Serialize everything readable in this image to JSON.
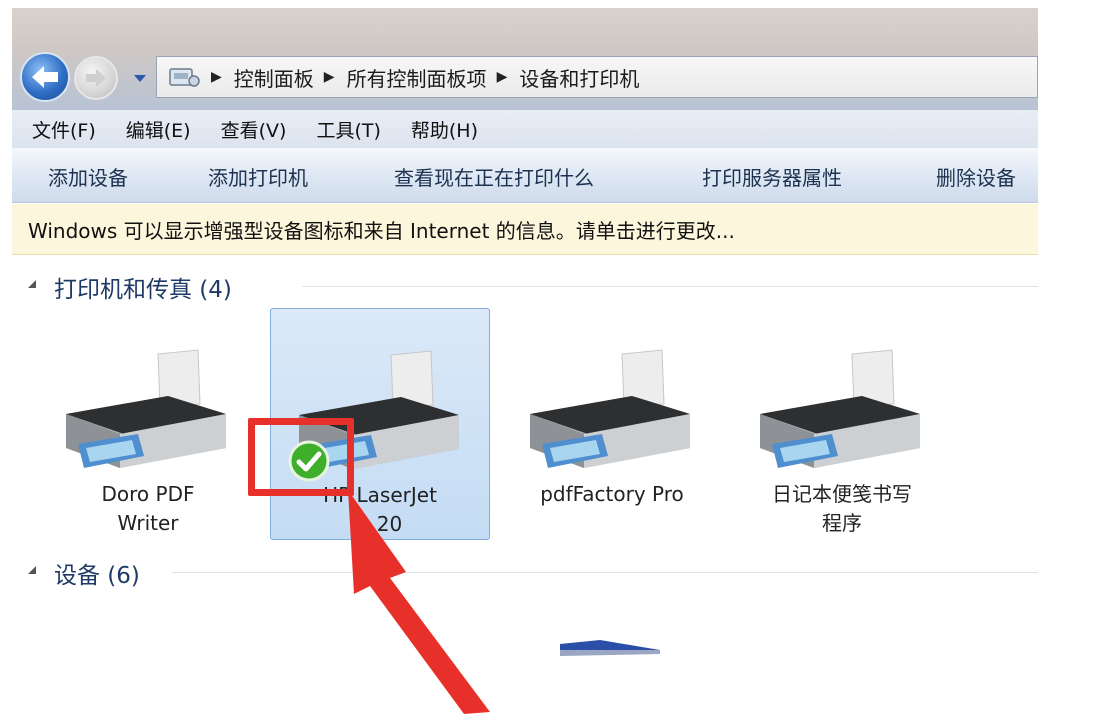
{
  "address": {
    "crumbs": [
      "控制面板",
      "所有控制面板项",
      "设备和打印机"
    ]
  },
  "menu": [
    "文件(F)",
    "编辑(E)",
    "查看(V)",
    "工具(T)",
    "帮助(H)"
  ],
  "commands": [
    "添加设备",
    "添加打印机",
    "查看现在正在打印什么",
    "打印服务器属性",
    "删除设备"
  ],
  "infobar": "Windows 可以显示增强型设备图标和来自 Internet 的信息。请单击进行更改...",
  "groups": {
    "printers_title": "打印机和传真 (4)",
    "devices_title": "设备 (6)"
  },
  "printers": [
    {
      "label_line1": "Doro PDF",
      "label_line2": "Writer",
      "selected": false,
      "default": false
    },
    {
      "label_line1": "HP LaserJet",
      "label_line2": "...20",
      "selected": true,
      "default": true
    },
    {
      "label_line1": "pdfFactory Pro",
      "label_line2": "",
      "selected": false,
      "default": false
    },
    {
      "label_line1": "日记本便笺书写",
      "label_line2": "程序",
      "selected": false,
      "default": false
    }
  ],
  "colors": {
    "highlight": "#e8302a",
    "selection": "#c4dcf4",
    "group_title": "#1e3a66"
  },
  "icons": [
    "back-arrow-icon",
    "forward-arrow-icon",
    "control-panel-icon",
    "printer-icon",
    "default-checkmark-icon",
    "red-pointer-arrow"
  ]
}
